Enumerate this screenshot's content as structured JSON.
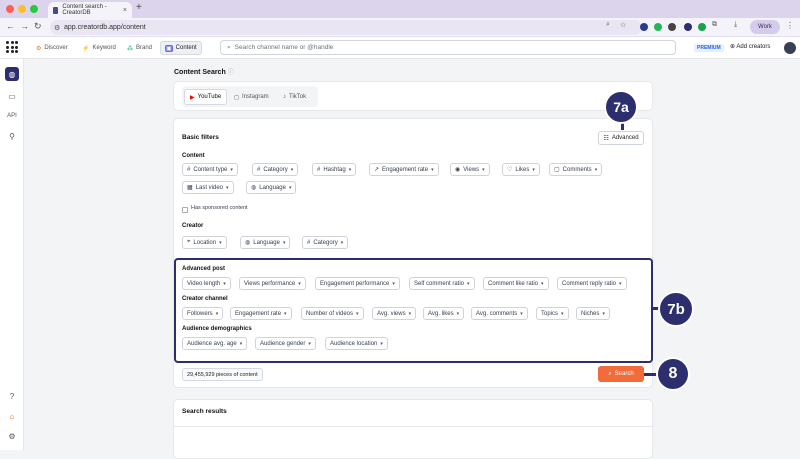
{
  "browser": {
    "tab_title": "Content search - CreatorDB",
    "url": "app.creatordb.app/content",
    "profile_label": "Work"
  },
  "app": {
    "nav_tabs": [
      "Discover",
      "Keyword",
      "Brand",
      "Content"
    ],
    "search_placeholder": "Search channel name or @handle",
    "premium_label": "PREMIUM",
    "add_creators_label": "Add creators",
    "sidebar_api_label": "API"
  },
  "page": {
    "title": "Content Search",
    "platforms": [
      "YouTube",
      "Instagram",
      "TikTok"
    ],
    "basic_filters_title": "Basic filters",
    "advanced_label": "Advanced",
    "content_label": "Content",
    "content_filters_row1": [
      "Content type",
      "Category",
      "Hashtag",
      "Engagement rate",
      "Views",
      "Likes",
      "Comments"
    ],
    "content_filters_row2": [
      "Last video",
      "Language"
    ],
    "sponsored_label": "Has sponsored content",
    "creator_label": "Creator",
    "creator_filters": [
      "Location",
      "Language",
      "Category"
    ],
    "advanced_post_label": "Advanced post",
    "advanced_post_filters": [
      "Video length",
      "Views performance",
      "Engagement performance",
      "Self comment ratio",
      "Comment like ratio",
      "Comment reply ratio"
    ],
    "creator_channel_label": "Creator channel",
    "creator_channel_filters": [
      "Followers",
      "Engagement rate",
      "Number of videos",
      "Avg. views",
      "Avg. likes",
      "Avg. comments",
      "Topics",
      "Niches"
    ],
    "audience_label": "Audience demographics",
    "audience_filters": [
      "Audience avg. age",
      "Audience gender",
      "Audience location"
    ],
    "results_count": "29,455,929 pieces of content",
    "search_button": "Search",
    "results_title": "Search results"
  },
  "annotations": {
    "badge_7a": "7a",
    "badge_7b": "7b",
    "badge_8": "8"
  },
  "colors": {
    "accent": "#2d2e6e",
    "search": "#f26b3a",
    "youtube": "#ff0000"
  }
}
